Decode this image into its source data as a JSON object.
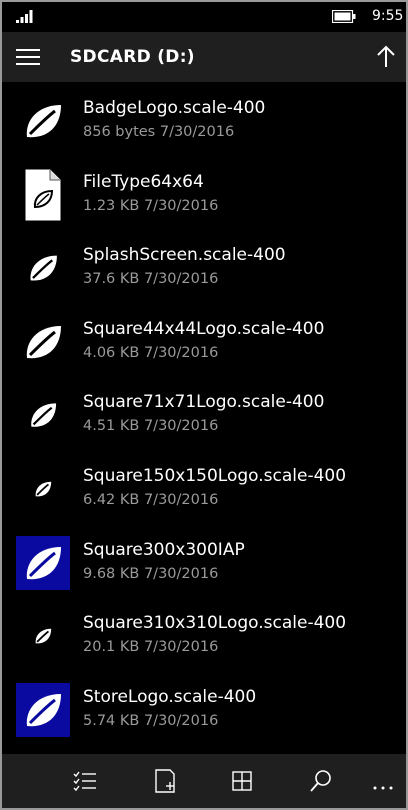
{
  "status_bar": {
    "time": "9:55",
    "signal_icon": "signal-strength-icon",
    "battery_icon": "battery-icon"
  },
  "header": {
    "title": "SDCARD (D:)",
    "menu_icon": "hamburger-menu-icon",
    "up_icon": "up-arrow-icon"
  },
  "files": [
    {
      "name": "BadgeLogo.scale-400",
      "meta": "856 bytes 7/30/2016",
      "thumb": "leaf-large"
    },
    {
      "name": "FileType64x64",
      "meta": "1.23 KB 7/30/2016",
      "thumb": "document"
    },
    {
      "name": "SplashScreen.scale-400",
      "meta": "37.6 KB 7/30/2016",
      "thumb": "leaf-medium"
    },
    {
      "name": "Square44x44Logo.scale-400",
      "meta": "4.06 KB 7/30/2016",
      "thumb": "leaf-large"
    },
    {
      "name": "Square71x71Logo.scale-400",
      "meta": "4.51 KB 7/30/2016",
      "thumb": "leaf-medium"
    },
    {
      "name": "Square150x150Logo.scale-400",
      "meta": "6.42 KB 7/30/2016",
      "thumb": "leaf-small"
    },
    {
      "name": "Square300x300IAP",
      "meta": "9.68 KB 7/30/2016",
      "thumb": "leaf-blue"
    },
    {
      "name": "Square310x310Logo.scale-400",
      "meta": "20.1 KB 7/30/2016",
      "thumb": "leaf-small"
    },
    {
      "name": "StoreLogo.scale-400",
      "meta": "5.74 KB 7/30/2016",
      "thumb": "leaf-blue"
    }
  ],
  "app_bar": {
    "buttons": [
      {
        "icon": "select-list-icon"
      },
      {
        "icon": "new-file-icon"
      },
      {
        "icon": "grid-view-icon"
      },
      {
        "icon": "search-icon"
      },
      {
        "icon": "more-options-icon"
      }
    ]
  },
  "colors": {
    "background": "#000000",
    "bar": "#1f1f1f",
    "meta_text": "#9a9a9a",
    "tile_blue": "#0a0aa0"
  }
}
